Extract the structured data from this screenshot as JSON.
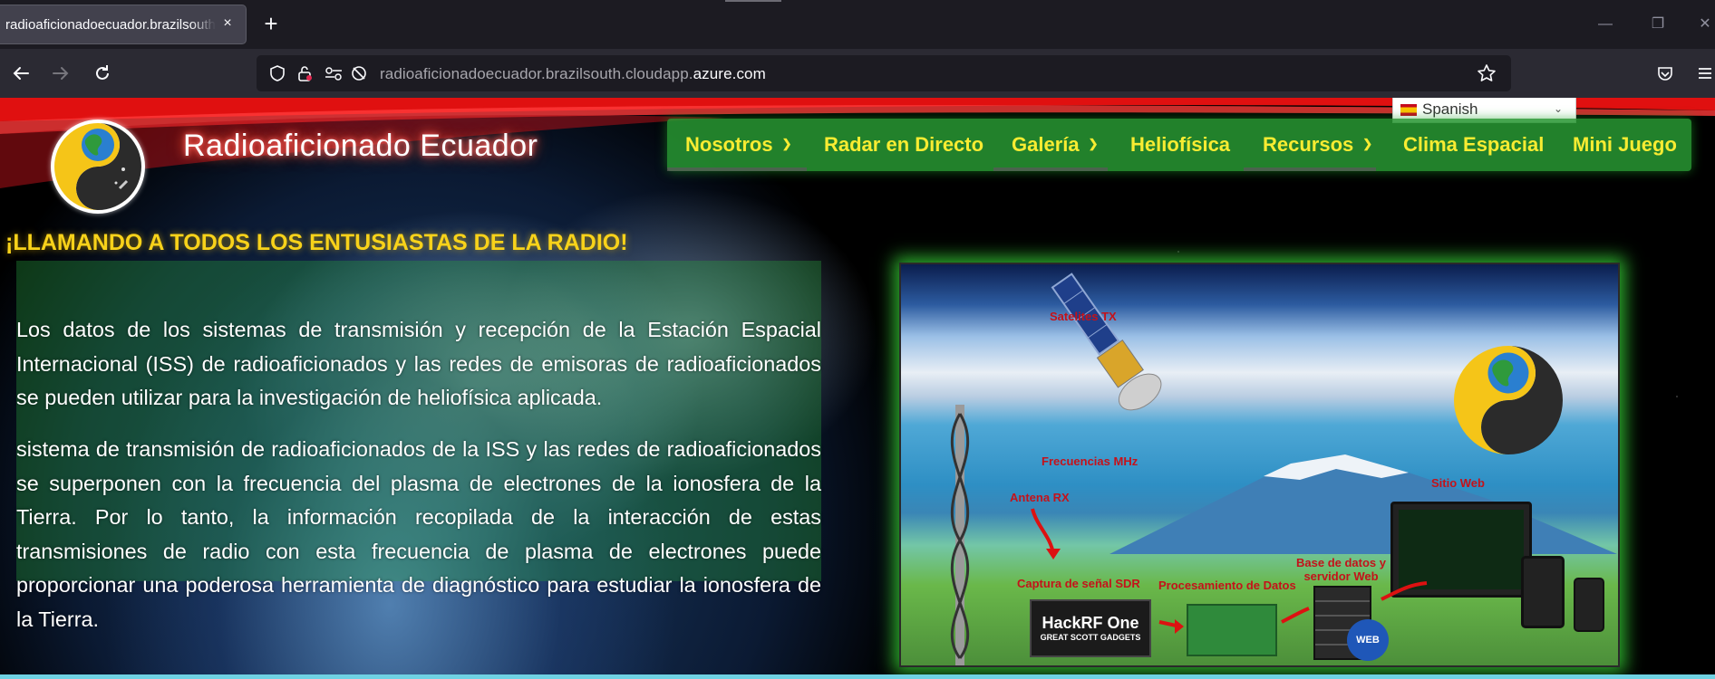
{
  "browser": {
    "tab_title": "radioaficionadoecuador.brazilsouth.cloudapp.azure.com",
    "tab_close_icon": "×",
    "new_tab_icon": "+",
    "url_prefix": "radioaficionadoecuador.brazilsouth.cloudapp.",
    "url_domain": "azure.com"
  },
  "site": {
    "title": "Radioaficionado Ecuador",
    "language": "Spanish",
    "nav": [
      {
        "label": "Nosotros",
        "dropdown": true
      },
      {
        "label": "Radar en Directo",
        "dropdown": false
      },
      {
        "label": "Galería",
        "dropdown": true
      },
      {
        "label": "Heliofísica",
        "dropdown": false
      },
      {
        "label": "Recursos",
        "dropdown": true
      },
      {
        "label": "Clima Espacial",
        "dropdown": false
      },
      {
        "label": "Mini Juego",
        "dropdown": false
      }
    ]
  },
  "content": {
    "headline": "¡LLAMANDO A TODOS LOS ENTUSIASTAS DE LA RADIO!",
    "paragraph1": "Los datos de los sistemas de transmisión y recepción de la Estación Espacial Internacional (ISS) de radioaficionados y las redes de emisoras de radioaficionados se pueden utilizar para la investigación de heliofísica aplicada.",
    "paragraph2": "sistema de transmisión de radioaficionados de la ISS y las redes de radioaficionados se superponen con la frecuencia del plasma de electrones de la ionosfera de la Tierra. Por lo tanto, la información recopilada de la interacción de estas transmisiones de radio con esta frecuencia de plasma de electrones puede proporcionar una poderosa herramienta de diagnóstico para estudiar la ionosfera de la Tierra."
  },
  "figure": {
    "labels": {
      "satelites": "Satelites TX",
      "frecuencias": "Frecuencias MHz",
      "antena": "Antena RX",
      "captura": "Captura de señal SDR",
      "procesamiento": "Procesamiento de Datos",
      "base_datos_1": "Base de datos y",
      "base_datos_2": "servidor Web",
      "sitio_web": "Sitio Web",
      "hackrf_1": "HackRF One",
      "hackrf_2": "GREAT SCOTT GADGETS",
      "web": "WEB"
    }
  },
  "colors": {
    "nav_bg": "#2a9632",
    "nav_text": "#f8ec32",
    "headline": "#f8d21a",
    "figure_glow": "#3ce63c"
  }
}
